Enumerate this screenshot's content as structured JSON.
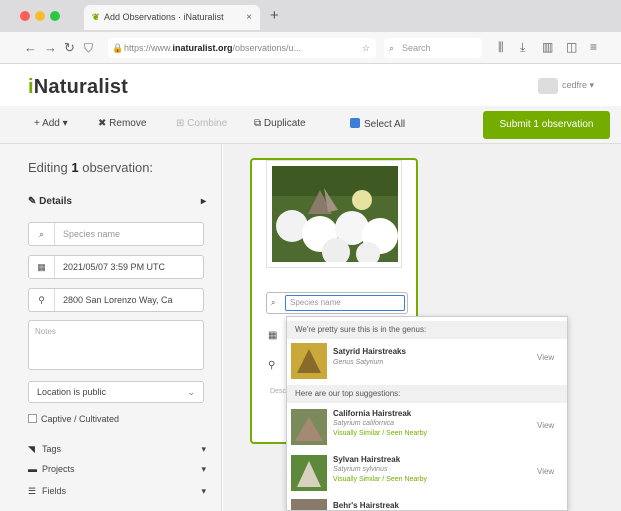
{
  "browser": {
    "tab_title": "Add Observations · iNaturalist",
    "tab_close": "×",
    "new_tab": "+",
    "url_prefix": "https://www.",
    "url_domain": "inaturalist.org",
    "url_path": "/observations/u...",
    "search_placeholder": "Search"
  },
  "header": {
    "logo_prefix": "i",
    "logo_name": "Naturalist",
    "username": "cedfre ▾"
  },
  "toolbar": {
    "add": "+ Add ▾",
    "remove": "✖ Remove",
    "combine": "⊞ Combine",
    "duplicate": "⧉ Duplicate",
    "select_all": "Select All",
    "submit": "Submit 1 observation"
  },
  "left_panel": {
    "editing_prefix": "Editing ",
    "editing_count": "1",
    "editing_suffix": " observation:",
    "details_label": "Details",
    "species_placeholder": "Species name",
    "datetime": "2021/05/07 3:59 PM UTC",
    "location": "2800 San Lorenzo Way, Ca",
    "notes_placeholder": "Notes",
    "geoprivacy": "Location is public",
    "captive_label": "Captive / Cultivated",
    "tags_label": "Tags",
    "projects_label": "Projects",
    "fields_label": "Fields"
  },
  "card": {
    "species_placeholder": "Species name",
    "notes_placeholder": "Descr..."
  },
  "dropdown": {
    "genus_header": "We're pretty sure this is in the genus:",
    "top_header": "Here are our top suggestions:",
    "view": "View",
    "genus_result": {
      "name": "Satyrid Hairstreaks",
      "sci": "Genus Satyrium"
    },
    "suggestions": [
      {
        "name": "California Hairstreak",
        "sci": "Satyrium californica",
        "seen": "Visually Similar / Seen Nearby"
      },
      {
        "name": "Sylvan Hairstreak",
        "sci": "Satyrium sylvinus",
        "seen": "Visually Similar / Seen Nearby"
      },
      {
        "name": "Behr's Hairstreak",
        "sci": "",
        "seen": ""
      }
    ]
  },
  "colors": {
    "brand_green": "#74ac00",
    "accent_blue": "#3b7dd8"
  }
}
